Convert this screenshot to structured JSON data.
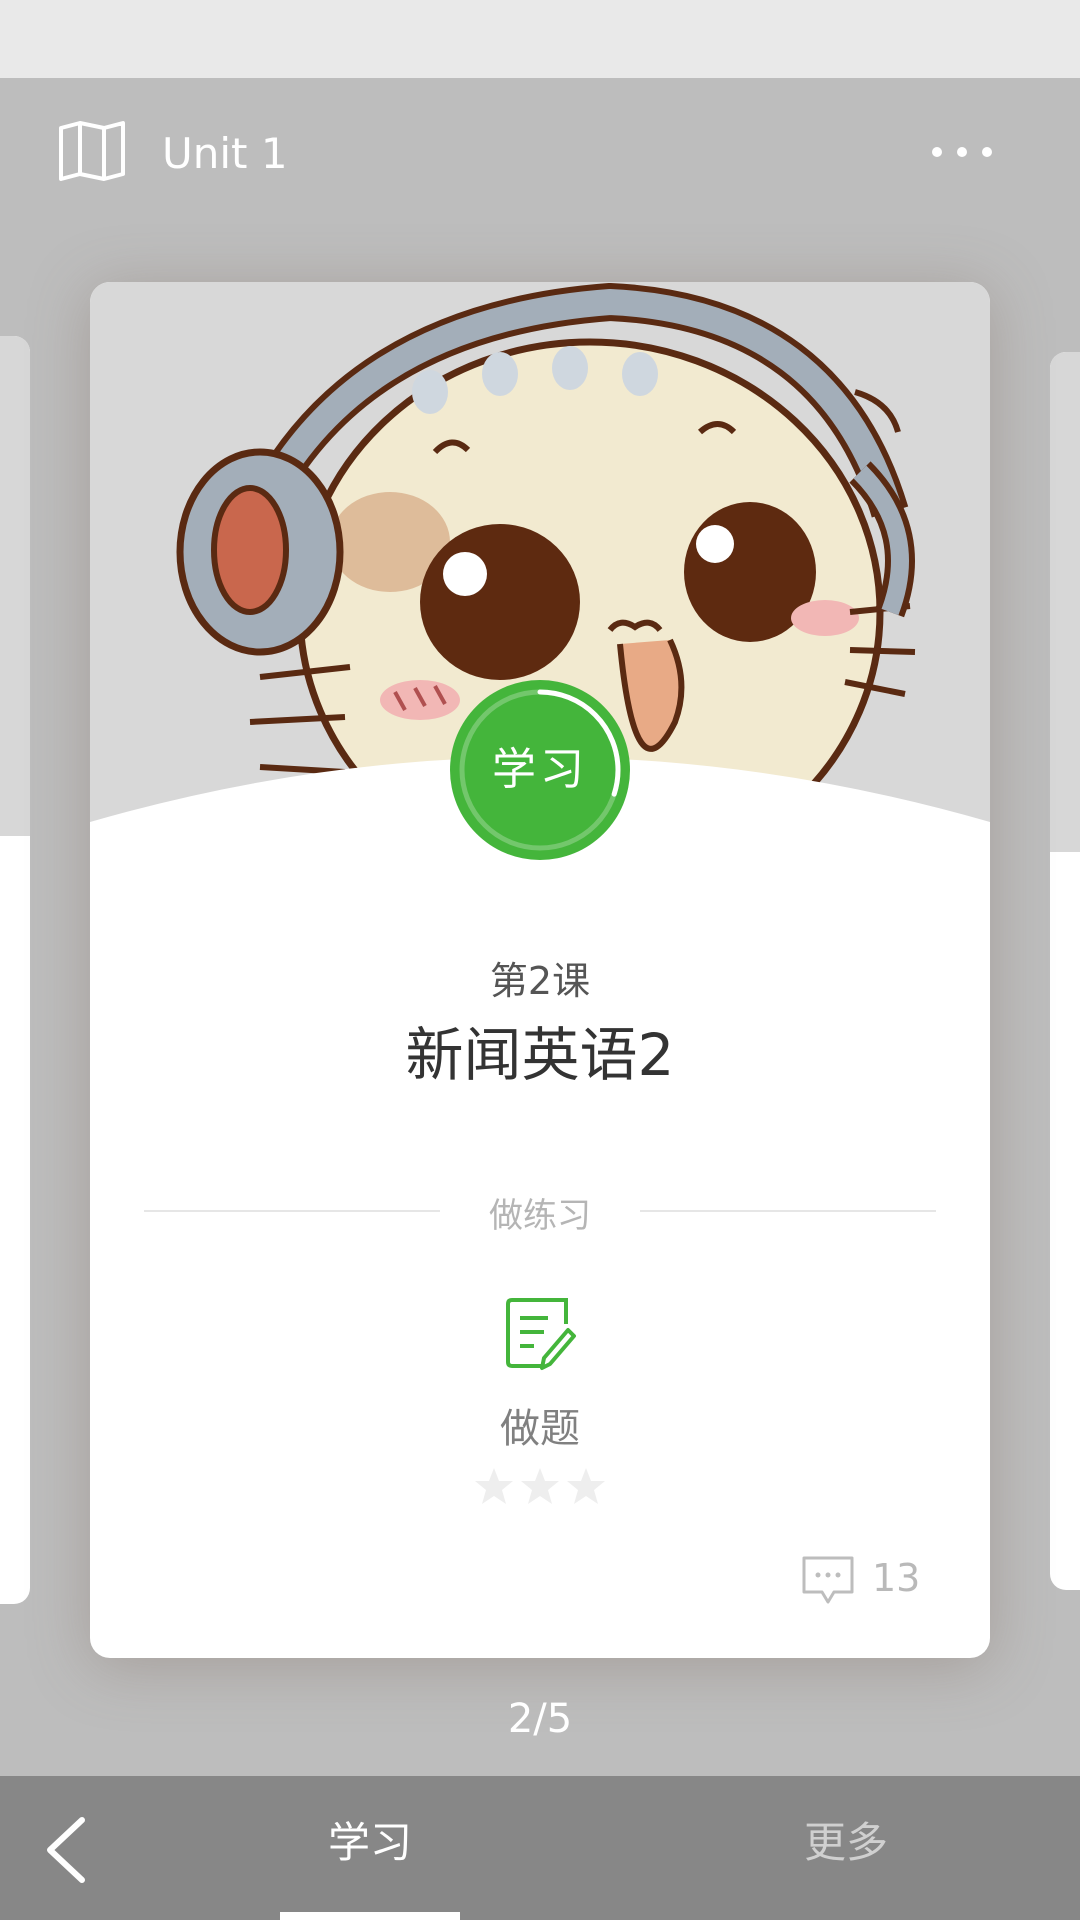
{
  "header": {
    "title": "Unit 1",
    "map_icon": "map-icon",
    "more_icon": "more-horizontal-icon"
  },
  "lesson_card": {
    "badge_label": "学习",
    "badge_progress": 0.3,
    "lesson_number": "第2课",
    "lesson_title": "新闻英语2",
    "section_label": "做练习",
    "exercise": {
      "icon": "exercise-edit-icon",
      "label": "做题",
      "stars_earned": 0,
      "stars_total": 3
    },
    "comments": {
      "icon": "comment-icon",
      "count": "13"
    }
  },
  "pager": {
    "text": "2/5"
  },
  "bottom_nav": {
    "back_icon": "chevron-left-icon",
    "tabs": [
      {
        "label": "学习",
        "active": true
      },
      {
        "label": "更多",
        "active": false
      }
    ]
  },
  "colors": {
    "accent_green": "#44b53b",
    "background": "#bdbdbd",
    "bottom_bar": "#878787",
    "status_bar": "#e9e9e9"
  }
}
